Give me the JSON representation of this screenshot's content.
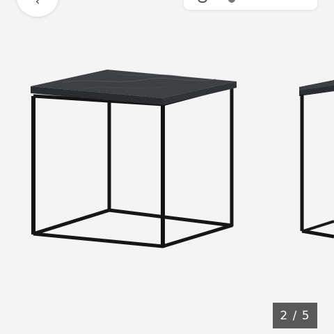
{
  "gallery": {
    "current": "2",
    "separator": "/",
    "total": "5",
    "background_color": "#f4f4f4",
    "counter_color": "#595959",
    "table_frame_color": "#141414",
    "table_top_color": "#3c3e41"
  },
  "icons": {
    "back": "chevron-left-icon"
  }
}
